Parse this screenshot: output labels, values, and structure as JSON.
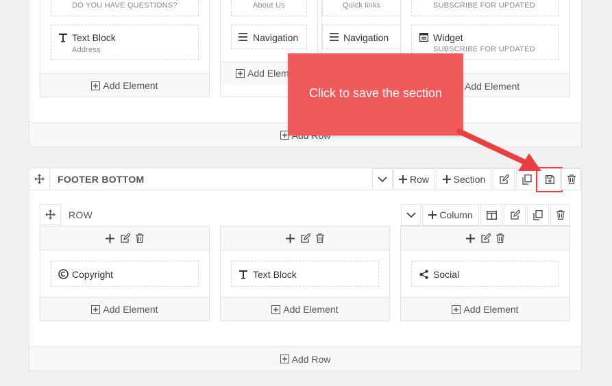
{
  "top_section": {
    "columns": [
      {
        "prev_sub": "DO YOU HAVE QUESTIONS?",
        "element_label": "Text Block",
        "element_sub": "Address",
        "add_element": "Add Element"
      },
      {
        "prev_sub": "About Us",
        "element_label": "Navigation",
        "add_element": "Add Element"
      },
      {
        "prev_sub": "Quick links",
        "element_label": "Navigation"
      },
      {
        "prev_sub": "SUBSCRIBE FOR UPDATED",
        "element_label": "Widget",
        "element_sub": "SUBSCRIBE FOR UPDATED",
        "add_element": "Add Element"
      }
    ],
    "add_row": "Add Row"
  },
  "footer_bottom": {
    "title": "FOOTER BOTTOM",
    "row_btn": "Row",
    "section_btn": "Section",
    "row": {
      "title": "ROW",
      "column_btn": "Column",
      "columns": [
        {
          "element_label": "Copyright",
          "add_element": "Add Element"
        },
        {
          "element_label": "Text Block",
          "add_element": "Add Element"
        },
        {
          "element_label": "Social",
          "add_element": "Add Element"
        }
      ]
    },
    "add_row": "Add Row"
  },
  "callout": {
    "text": "Click to save the section",
    "color": "#f05a5a"
  }
}
